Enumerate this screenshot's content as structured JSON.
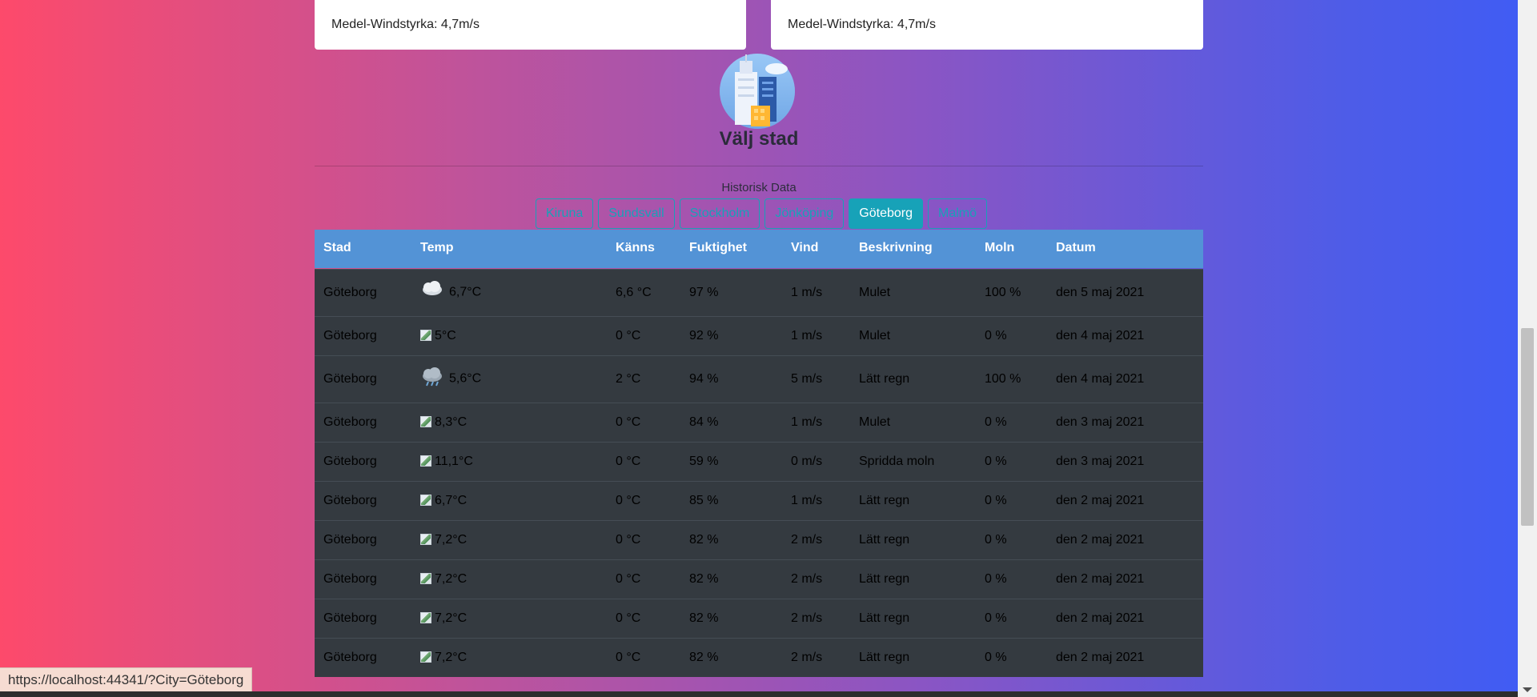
{
  "cards": {
    "left_text": "Medel-Windstyrka: 4,7m/s",
    "right_text": "Medel-Windstyrka: 4,7m/s"
  },
  "city_section": {
    "title": "Välj stad",
    "history_label": "Historisk Data",
    "tabs": [
      {
        "label": "Kiruna",
        "active": false
      },
      {
        "label": "Sundsvall",
        "active": false
      },
      {
        "label": "Stockholm",
        "active": false
      },
      {
        "label": "Jönköping",
        "active": false
      },
      {
        "label": "Göteborg",
        "active": true
      },
      {
        "label": "Malmö",
        "active": false
      }
    ]
  },
  "table": {
    "headers": [
      "Stad",
      "Temp",
      "Känns",
      "Fuktighet",
      "Vind",
      "Beskrivning",
      "Moln",
      "Datum"
    ],
    "rows": [
      {
        "stad": "Göteborg",
        "icon": "cloud-icon",
        "temp": "6,7°C",
        "kanns": "6,6 °C",
        "fukt": "97 %",
        "vind": "1 m/s",
        "besk": "Mulet",
        "moln": "100 %",
        "datum": "den 5 maj 2021"
      },
      {
        "stad": "Göteborg",
        "icon": "broken-image-icon",
        "temp": "5°C",
        "kanns": "0 °C",
        "fukt": "92 %",
        "vind": "1 m/s",
        "besk": "Mulet",
        "moln": "0 %",
        "datum": "den 4 maj 2021"
      },
      {
        "stad": "Göteborg",
        "icon": "rain-cloud-icon",
        "temp": "5,6°C",
        "kanns": "2 °C",
        "fukt": "94 %",
        "vind": "5 m/s",
        "besk": "Lätt regn",
        "moln": "100 %",
        "datum": "den 4 maj 2021"
      },
      {
        "stad": "Göteborg",
        "icon": "broken-image-icon",
        "temp": "8,3°C",
        "kanns": "0 °C",
        "fukt": "84 %",
        "vind": "1 m/s",
        "besk": "Mulet",
        "moln": "0 %",
        "datum": "den 3 maj 2021"
      },
      {
        "stad": "Göteborg",
        "icon": "broken-image-icon",
        "temp": "11,1°C",
        "kanns": "0 °C",
        "fukt": "59 %",
        "vind": "0 m/s",
        "besk": "Spridda moln",
        "moln": "0 %",
        "datum": "den 3 maj 2021"
      },
      {
        "stad": "Göteborg",
        "icon": "broken-image-icon",
        "temp": "6,7°C",
        "kanns": "0 °C",
        "fukt": "85 %",
        "vind": "1 m/s",
        "besk": "Lätt regn",
        "moln": "0 %",
        "datum": "den 2 maj 2021"
      },
      {
        "stad": "Göteborg",
        "icon": "broken-image-icon",
        "temp": "7,2°C",
        "kanns": "0 °C",
        "fukt": "82 %",
        "vind": "2 m/s",
        "besk": "Lätt regn",
        "moln": "0 %",
        "datum": "den 2 maj 2021"
      },
      {
        "stad": "Göteborg",
        "icon": "broken-image-icon",
        "temp": "7,2°C",
        "kanns": "0 °C",
        "fukt": "82 %",
        "vind": "2 m/s",
        "besk": "Lätt regn",
        "moln": "0 %",
        "datum": "den 2 maj 2021"
      },
      {
        "stad": "Göteborg",
        "icon": "broken-image-icon",
        "temp": "7,2°C",
        "kanns": "0 °C",
        "fukt": "82 %",
        "vind": "2 m/s",
        "besk": "Lätt regn",
        "moln": "0 %",
        "datum": "den 2 maj 2021"
      },
      {
        "stad": "Göteborg",
        "icon": "broken-image-icon",
        "temp": "7,2°C",
        "kanns": "0 °C",
        "fukt": "82 %",
        "vind": "2 m/s",
        "besk": "Lätt regn",
        "moln": "0 %",
        "datum": "den 2 maj 2021"
      }
    ]
  },
  "status_bar": {
    "url": "https://localhost:44341/?City=Göteborg"
  },
  "colors": {
    "tab_accent": "#17a2b8",
    "table_header": "#5393d6",
    "table_body": "#343a40"
  }
}
